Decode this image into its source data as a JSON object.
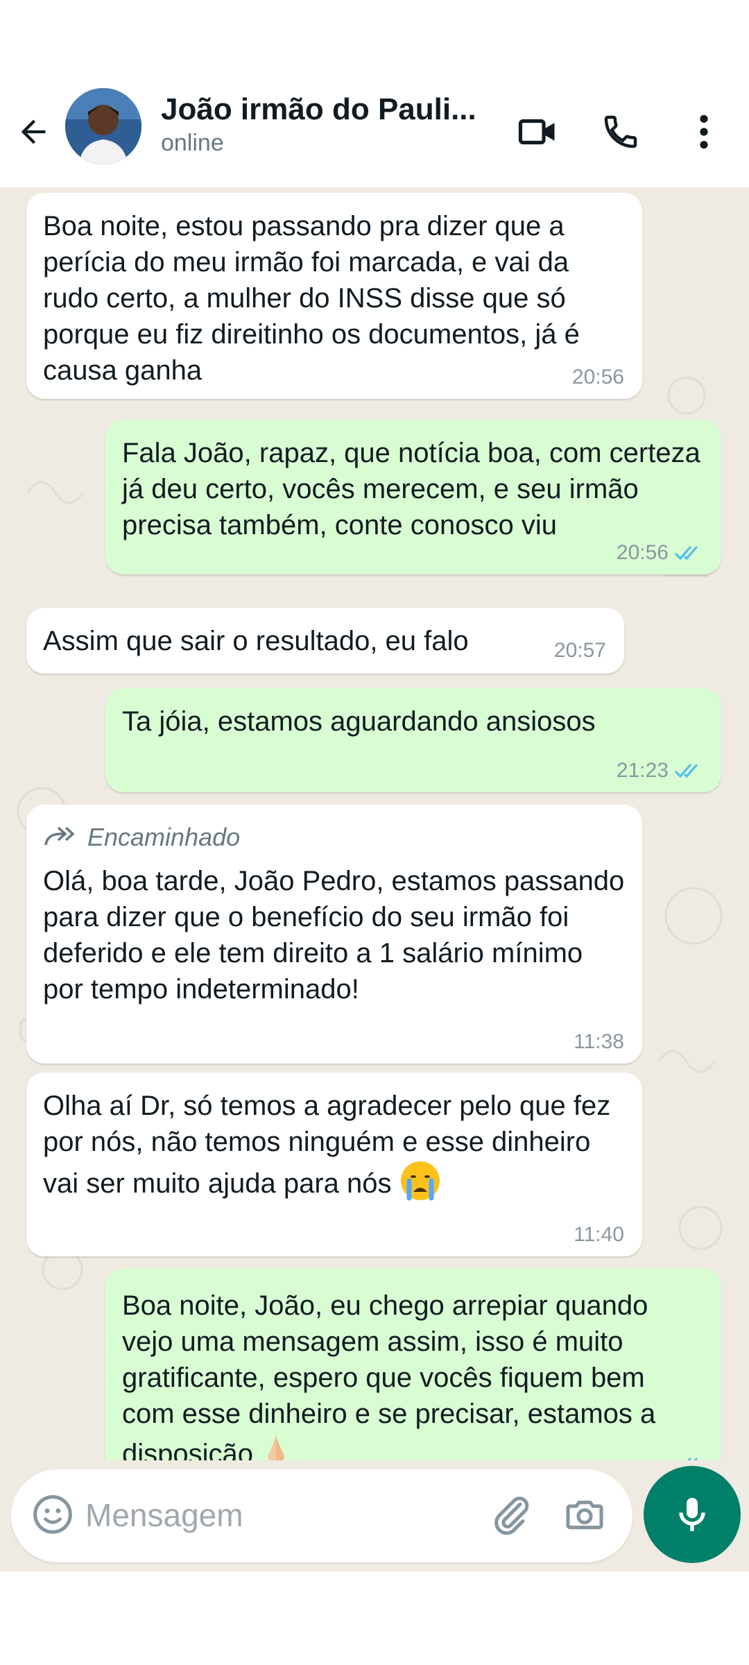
{
  "header": {
    "contact_name": "João irmão do Pauli...",
    "status": "online",
    "icons": [
      "back-arrow-icon",
      "avatar",
      "video-call-icon",
      "phone-call-icon",
      "more-options-icon"
    ]
  },
  "messages": [
    {
      "direction": "in",
      "text": "Boa noite, estou passando pra dizer que a perícia do meu irmão foi marcada, e vai da rudo certo, a mulher do INSS disse que só porque eu fiz direitinho os documentos, já é causa ganha",
      "time": "20:56"
    },
    {
      "direction": "out",
      "text": "Fala João, rapaz, que notícia boa, com certeza já deu certo, vocês merecem, e seu irmão precisa também, conte conosco viu",
      "time": "20:56",
      "read": true
    },
    {
      "direction": "in",
      "text": "Assim que sair o resultado, eu falo",
      "time": "20:57"
    },
    {
      "direction": "out",
      "text": "Ta jóia, estamos aguardando ansiosos",
      "time": "21:23",
      "read": true
    },
    {
      "direction": "in",
      "forwarded_label": "Encaminhado",
      "text": "Olá, boa tarde, João Pedro, estamos passando para dizer que o benefício do seu irmão foi deferido e ele tem direito a 1 salário mínimo por tempo indeterminado!",
      "time": "11:38"
    },
    {
      "direction": "in",
      "text": "Olha aí Dr, só temos a agradecer pelo que fez por nós, não temos ninguém e esse dinheiro vai ser muito ajuda para nós",
      "emoji": "😭",
      "time": "11:40"
    },
    {
      "direction": "out",
      "text": "Boa noite, João, eu chego arrepiar quando vejo uma mensagem assim, isso é muito gratificante, espero que vocês fiquem bem com esse dinheiro e se precisar, estamos a disposição",
      "emoji": "🙏",
      "read": true
    }
  ],
  "composer": {
    "placeholder": "Mensagem",
    "icons": [
      "emoji-icon",
      "attach-icon",
      "camera-icon",
      "mic-icon"
    ]
  },
  "colors": {
    "incoming": "#ffffff",
    "outgoing": "#d9fdd3",
    "chat_bg": "#efeae2",
    "read_ticks": "#53bdeb",
    "accent": "#008069"
  }
}
